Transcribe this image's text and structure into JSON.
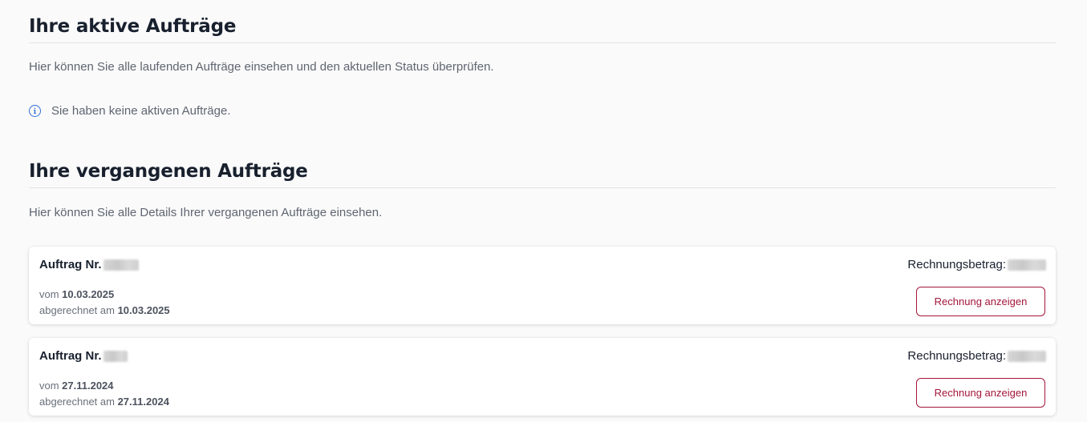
{
  "active_orders": {
    "title": "Ihre aktive Aufträge",
    "intro": "Hier können Sie alle laufenden Aufträge einsehen und den aktuellen Status überprüfen.",
    "empty_message": "Sie haben keine aktiven Aufträge.",
    "info_icon": "info-circle-icon"
  },
  "past_orders": {
    "title": "Ihre vergangenen Aufträge",
    "intro": "Hier können Sie alle Details Ihrer vergangenen Aufträge einsehen.",
    "orders": [
      {
        "order_label": "Auftrag Nr.",
        "amount_label": "Rechnungsbetrag:",
        "from_prefix": "vom",
        "from_date": "10.03.2025",
        "billed_prefix": "abgerechnet am",
        "billed_date": "10.03.2025",
        "button_label": "Rechnung anzeigen"
      },
      {
        "order_label": "Auftrag Nr.",
        "amount_label": "Rechnungsbetrag:",
        "from_prefix": "vom",
        "from_date": "27.11.2024",
        "billed_prefix": "abgerechnet am",
        "billed_date": "27.11.2024",
        "button_label": "Rechnung anzeigen"
      }
    ]
  },
  "colors": {
    "accent": "#a3163a",
    "info": "#2f6fd6",
    "heading": "#18202e",
    "muted_text": "#5f6571",
    "background": "#fafafa"
  }
}
